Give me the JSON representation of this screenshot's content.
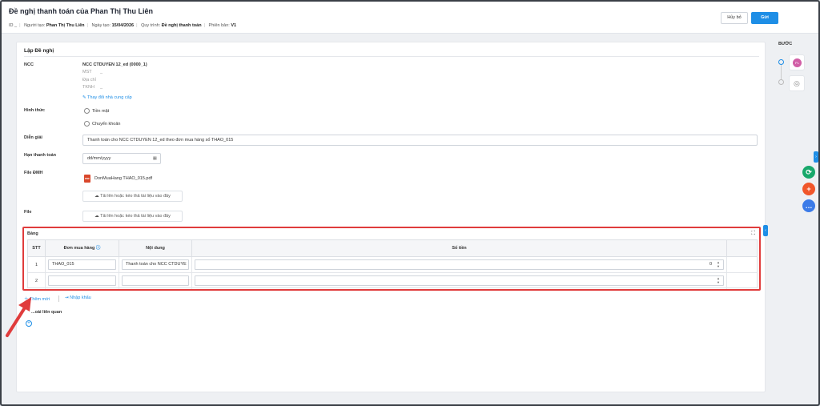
{
  "header": {
    "title": "Đề nghị thanh toán của Phan Thị Thu Liên",
    "id_label": "ID",
    "id_value": "_",
    "creator_label": "Người tạo:",
    "creator_value": "Phan Thị Thu Liên",
    "date_label": "Ngày tạo:",
    "date_value": "15/04/2026",
    "process_label": "Quy trình:",
    "process_value": "Đề nghị thanh toán",
    "version_label": "Phiên bản:",
    "version_value": "V1",
    "cancel_label": "Hủy bỏ",
    "send_label": "Gửi"
  },
  "form": {
    "section_title": "Lập Đề nghị",
    "ncc_label": "NCC",
    "ncc_name": "NCC CTDUYEN 12_ed (0000_1)",
    "mst_label": "MST",
    "mst_value": "_",
    "address_label": "Địa chỉ",
    "tkhh_label": "TKNH",
    "tkhh_value": "_",
    "change_supplier": "Thay đổi nhà cung cấp",
    "method_label": "Hình thức",
    "method_options": [
      "Tiền mặt",
      "Chuyển khoản"
    ],
    "desc_label": "Diễn giải",
    "desc_value": "Thanh toán cho NCC CTDUYEN 12_ed theo đơn mua hàng số THAO_015",
    "due_label": "Hạn thanh toán",
    "due_placeholder": "dd/mm/yyyy",
    "file_dmh_label": "File ĐMH",
    "file_dmh_name": "DonMuaHang THAO_015.pdf",
    "upload_text": "Tải lên hoặc kéo thả tài liệu vào đây",
    "file_label": "File"
  },
  "table": {
    "title": "Bảng",
    "headers": [
      "STT",
      "Đơn mua hàng",
      "Nội dung",
      "Số tiền"
    ],
    "rows": [
      {
        "stt": "1",
        "order": "THAO_015",
        "content": "Thanh toán cho NCC CTDUYE",
        "amount": "0"
      },
      {
        "stt": "2",
        "order": "",
        "content": "",
        "amount": ""
      }
    ]
  },
  "actions": {
    "add_new": "Thêm mới",
    "import": "Nhập khẩu",
    "related_label": "...oài liên quan"
  },
  "steps": {
    "title": "BƯỚC"
  },
  "colors": {
    "accent": "#1e8ee6",
    "highlight": "#e03c3c"
  }
}
